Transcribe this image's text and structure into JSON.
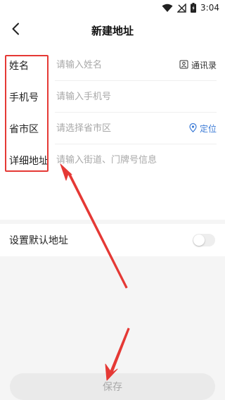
{
  "status_bar": {
    "time": "3:04"
  },
  "header": {
    "title": "新建地址"
  },
  "form": {
    "name": {
      "label": "姓名",
      "placeholder": "请输入姓名",
      "action": "通讯录"
    },
    "phone": {
      "label": "手机号",
      "placeholder": "请输入手机号"
    },
    "region": {
      "label": "省市区",
      "placeholder": "请选择省市区",
      "action": "定位"
    },
    "address": {
      "label": "详细地址",
      "placeholder": "请输入街道、门牌号信息"
    }
  },
  "default_address": {
    "label": "设置默认地址",
    "enabled": false
  },
  "footer": {
    "save_label": "保存"
  },
  "colors": {
    "accent": "#3c7bd6",
    "annotation": "#e53935",
    "placeholder": "#a8a8a8",
    "button_bg": "#eaeaea"
  },
  "icons": [
    "wifi-icon",
    "signal-off-icon",
    "battery-charging-icon",
    "back-arrow-icon",
    "contacts-icon",
    "location-pin-icon"
  ]
}
